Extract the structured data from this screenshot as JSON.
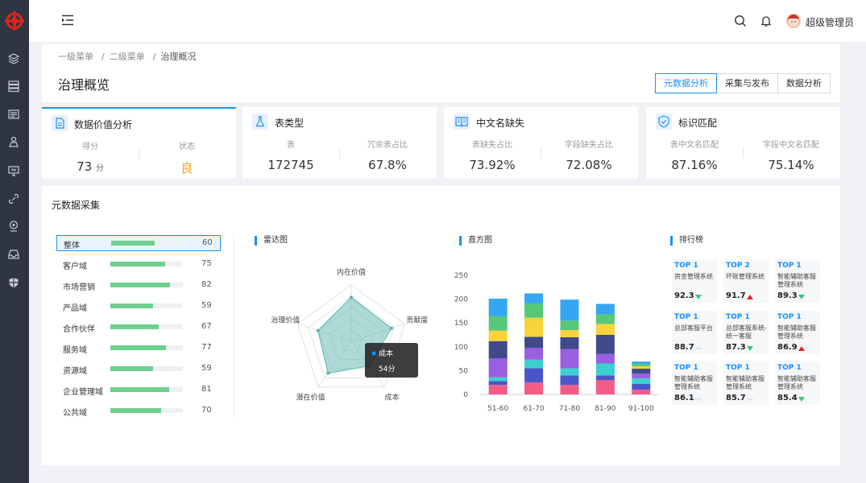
{
  "topbar": {
    "user_name": "超级管理员"
  },
  "breadcrumb": {
    "level1": "一级菜单",
    "level2": "二级菜单",
    "current": "治理概况"
  },
  "header": {
    "title": "治理概览",
    "tabs": [
      {
        "label": "元数据分析",
        "active": true
      },
      {
        "label": "采集与发布",
        "active": false
      },
      {
        "label": "数据分析",
        "active": false
      }
    ]
  },
  "stats": [
    {
      "title": "数据价值分析",
      "icon": "document-icon",
      "cols": [
        {
          "label": "得分",
          "value": "73",
          "unit": "分"
        },
        {
          "label": "状态",
          "value": "良",
          "color": "#f0a020"
        }
      ]
    },
    {
      "title": "表类型",
      "icon": "flask-icon",
      "cols": [
        {
          "label": "表",
          "value": "172745"
        },
        {
          "label": "冗余表占比",
          "value": "67.8%"
        }
      ]
    },
    {
      "title": "中文名缺失",
      "icon": "book-icon",
      "cols": [
        {
          "label": "表缺失占比",
          "value": "73.92%"
        },
        {
          "label": "字段缺失占比",
          "value": "72.08%"
        }
      ]
    },
    {
      "title": "标识匹配",
      "icon": "shield-check-icon",
      "cols": [
        {
          "label": "表中文名匹配",
          "value": "87.16%"
        },
        {
          "label": "字段中文名匹配",
          "value": "75.14%"
        }
      ]
    }
  ],
  "collection": {
    "title": "元数据采集",
    "domains": [
      {
        "name": "整体",
        "value": 60,
        "active": true
      },
      {
        "name": "客户域",
        "value": 75
      },
      {
        "name": "市场营销",
        "value": 82
      },
      {
        "name": "产品域",
        "value": 59
      },
      {
        "name": "合作伙伴",
        "value": 67
      },
      {
        "name": "服务域",
        "value": 77
      },
      {
        "name": "资源域",
        "value": 59
      },
      {
        "name": "企业管理域",
        "value": 81
      },
      {
        "name": "公共域",
        "value": 70
      }
    ],
    "bar_color": "#6fcf8f"
  },
  "radar": {
    "panel_title": "雷达图",
    "tooltip": {
      "series": "成本",
      "value": "54分"
    }
  },
  "histogram": {
    "panel_title": "直方图"
  },
  "ranking": {
    "panel_title": "排行榜",
    "cards": [
      {
        "rank": "TOP 1",
        "system": "资金管理系统",
        "score": "92.3",
        "trend": "down"
      },
      {
        "rank": "TOP 2",
        "system": "坏账管理系统",
        "score": "91.7",
        "trend": "up"
      },
      {
        "rank": "TOP 1",
        "system": "智能辅助客服管理系统",
        "score": "89.3",
        "trend": "down"
      },
      {
        "rank": "TOP 1",
        "system": "总部客服平台",
        "score": "88.7",
        "trend": "flat"
      },
      {
        "rank": "TOP 1",
        "system": "总部客服系统-统一客服",
        "score": "87.3",
        "trend": "down"
      },
      {
        "rank": "TOP 1",
        "system": "智能辅助客服管理系统",
        "score": "86.9",
        "trend": "up"
      },
      {
        "rank": "TOP 1",
        "system": "智能辅助客服管理系统",
        "score": "86.1",
        "trend": "flat"
      },
      {
        "rank": "TOP 1",
        "system": "智能辅助客服管理系统",
        "score": "85.7",
        "trend": "flat"
      },
      {
        "rank": "TOP 1",
        "system": "智能辅助客服管理系统",
        "score": "85.4",
        "trend": "down"
      }
    ]
  },
  "chart_data": [
    {
      "type": "radar",
      "indicators": [
        {
          "name": "内在价值",
          "max": 100
        },
        {
          "name": "贡献度",
          "max": 100
        },
        {
          "name": "成本",
          "max": 100
        },
        {
          "name": "潜在价值",
          "max": 100
        },
        {
          "name": "治理价值",
          "max": 100
        }
      ],
      "series": [
        {
          "name": "成本",
          "values": [
            78,
            75,
            54,
            70,
            62
          ]
        }
      ],
      "color": "#5bb5ad"
    },
    {
      "type": "bar",
      "stacked": true,
      "categories": [
        "51-60",
        "61-70",
        "71-80",
        "81-90",
        "91-100"
      ],
      "ylim": [
        0,
        250
      ],
      "yticks": [
        0,
        50,
        100,
        150,
        200,
        250
      ],
      "segment_colors": [
        "#f25c86",
        "#4a56c8",
        "#3ccfd0",
        "#9a5ee0",
        "#3e4a8a",
        "#f8d33a",
        "#56c878",
        "#35a6f2"
      ],
      "series": [
        {
          "values": [
            20,
            25,
            20,
            30,
            10
          ]
        },
        {
          "values": [
            8,
            30,
            20,
            10,
            12
          ]
        },
        {
          "values": [
            8,
            18,
            15,
            25,
            12
          ]
        },
        {
          "values": [
            40,
            25,
            40,
            20,
            10
          ]
        },
        {
          "values": [
            36,
            23,
            25,
            40,
            10
          ]
        },
        {
          "values": [
            22,
            40,
            15,
            23,
            5
          ]
        },
        {
          "values": [
            30,
            30,
            20,
            20,
            5
          ]
        },
        {
          "values": [
            37,
            21,
            44,
            22,
            5
          ]
        }
      ]
    }
  ]
}
